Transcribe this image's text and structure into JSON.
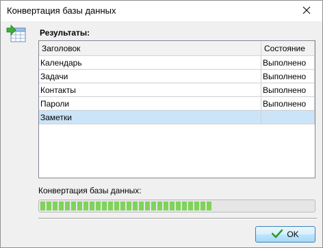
{
  "window": {
    "title": "Конвертация базы данных"
  },
  "icons": {
    "close": "close-icon",
    "app": "table-import-icon",
    "ok": "checkmark-icon"
  },
  "results": {
    "label": "Результаты:",
    "columns": [
      "Заголовок",
      "Состояние"
    ],
    "rows": [
      {
        "title": "Календарь",
        "status": "Выполнено"
      },
      {
        "title": "Задачи",
        "status": "Выполнено"
      },
      {
        "title": "Контакты",
        "status": "Выполнено"
      },
      {
        "title": "Пароли",
        "status": "Выполнено"
      },
      {
        "title": "Заметки",
        "status": ""
      }
    ],
    "selected_row": 4
  },
  "progress": {
    "label": "Конвертация базы данных:",
    "fraction": 0.63,
    "color": "#7ed35a"
  },
  "buttons": {
    "ok": "OK"
  }
}
